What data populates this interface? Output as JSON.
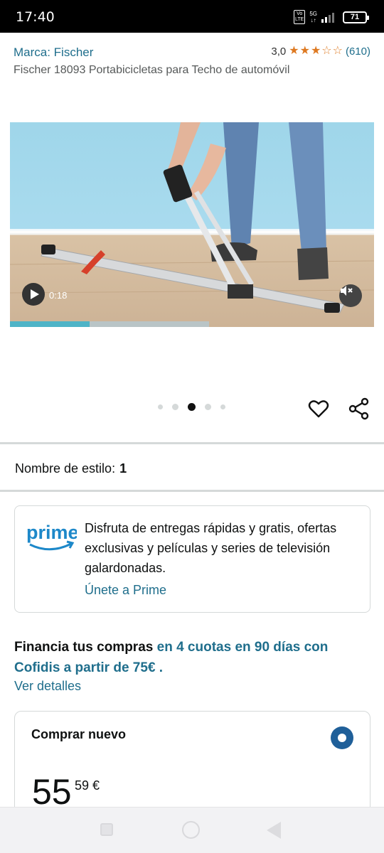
{
  "status_bar": {
    "time": "17:40",
    "volte": "Vo LTE",
    "network": "5G",
    "battery": "71"
  },
  "header": {
    "brand_link": "Marca: Fischer",
    "rating_value": "3,0",
    "rating_stars": 3,
    "rating_count": "(610)",
    "product_title": "Fischer 18093 Portabicicletas para Techo de automóvil"
  },
  "media": {
    "video_time": "0:18",
    "progress_fraction": 0.4,
    "carousel_count": 5,
    "carousel_active_index": 2
  },
  "style": {
    "label": "Nombre de estilo:",
    "value": "1"
  },
  "prime": {
    "logo_text": "prime",
    "description": "Disfruta de entregas rápidas y gratis, ofertas exclusivas y películas y series de televisión galardonadas.",
    "join_link": "Únete a Prime"
  },
  "financing": {
    "text_bold": "Financia tus compras",
    "text_highlight": "en 4 cuotas en 90 días con Cofidis a partir de 75€",
    "text_end": ".",
    "details_link": "Ver detalles"
  },
  "buy_box": {
    "title": "Comprar nuevo",
    "price_whole": "55",
    "price_fraction": "59 €"
  },
  "colors": {
    "link": "#1f6e8c",
    "star": "#de7921",
    "radio": "#1f5f99",
    "prime_blue": "#1d88c9"
  }
}
